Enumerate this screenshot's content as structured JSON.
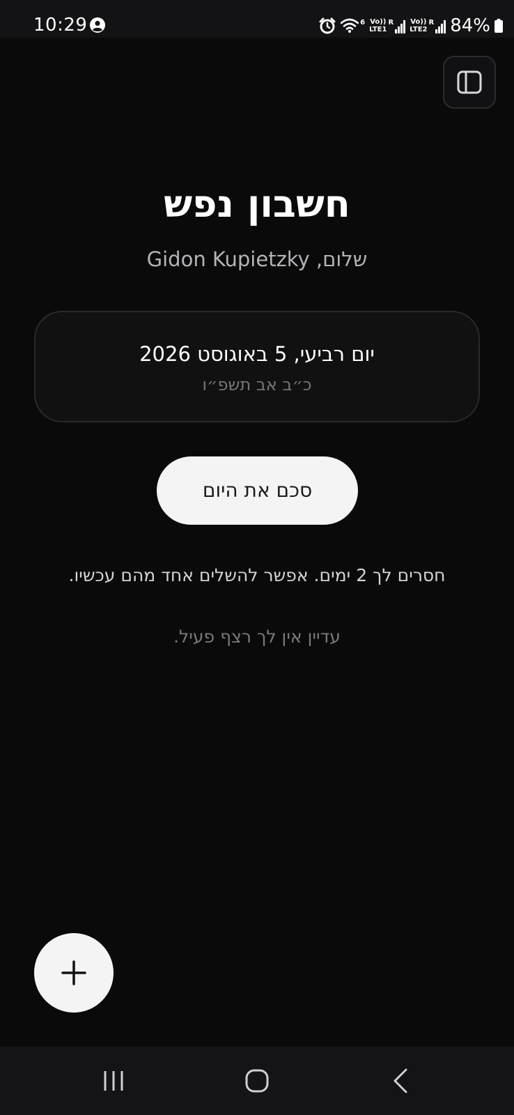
{
  "status_bar": {
    "time": "10:29",
    "lte1_label_top": "Vo))",
    "lte1_label_bottom": "LTE1",
    "lte2_label_top": "Vo))",
    "lte2_label_bottom": "LTE2",
    "roaming_mark": "R",
    "wifi_generation": "6",
    "battery_percent": "84%"
  },
  "header": {
    "title": "חשבון נפש",
    "greeting": "שלום, Gidon Kupietzky"
  },
  "date_card": {
    "gregorian_date": "יום רביעי, 5 באוגוסט 2026",
    "hebrew_date": "כ״ב אב תשפ״ו"
  },
  "actions": {
    "summarize_label": "סכם את היום"
  },
  "messages": {
    "missing_days": "חסרים לך 2 ימים. אפשר להשלים אחד מהם עכשיו.",
    "streak_status": "עדיין אין לך רצף פעיל."
  },
  "colors": {
    "background": "#0a0a0a",
    "card_border": "#2a2a2c",
    "button_bg": "#f4f4f4",
    "muted_text": "#77777b"
  },
  "icons": {
    "status_person": "person-circle-icon",
    "alarm": "alarm-icon",
    "wifi": "wifi-icon",
    "battery": "battery-icon",
    "sidebar_toggle": "sidebar-panel-icon",
    "add": "plus-icon",
    "nav_recent": "recent-apps-icon",
    "nav_home": "home-icon",
    "nav_back": "back-icon"
  }
}
